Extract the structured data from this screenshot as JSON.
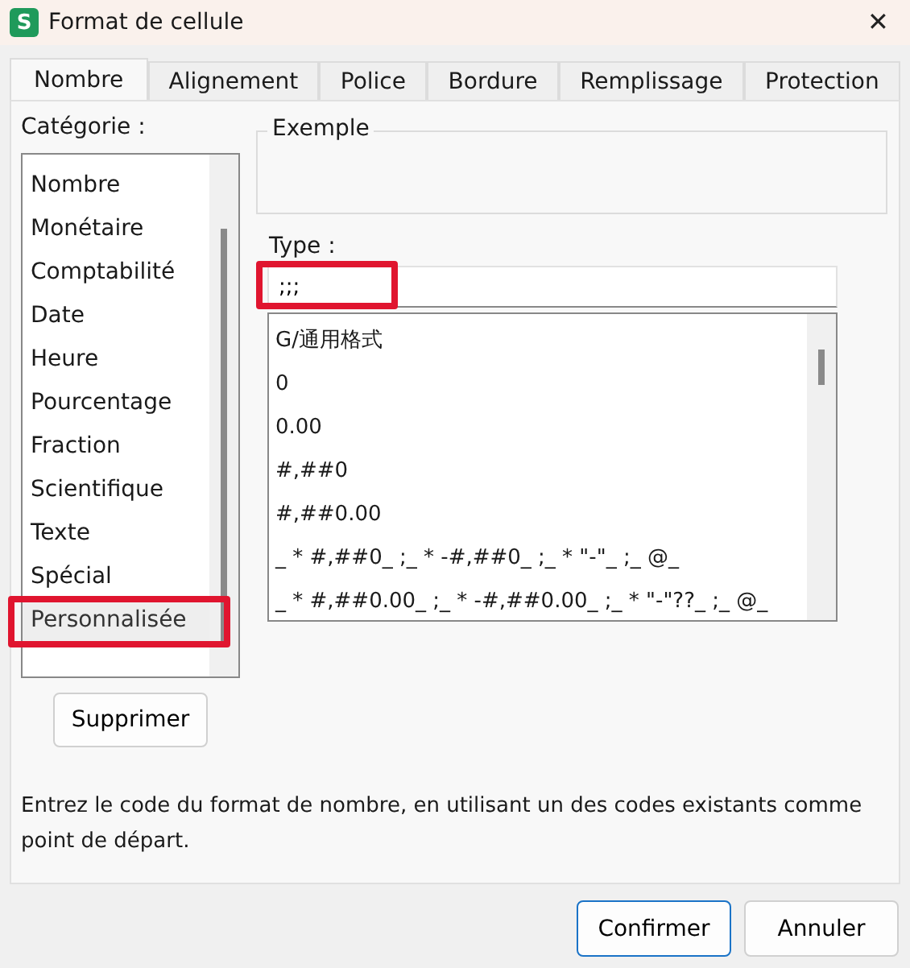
{
  "window": {
    "app_icon": "S",
    "title": "Format de cellule",
    "close": "✕"
  },
  "tabs": [
    {
      "label": "Nombre",
      "selected": true
    },
    {
      "label": "Alignement",
      "selected": false
    },
    {
      "label": "Police",
      "selected": false
    },
    {
      "label": "Bordure",
      "selected": false
    },
    {
      "label": "Remplissage",
      "selected": false
    },
    {
      "label": "Protection",
      "selected": false
    }
  ],
  "category": {
    "label": "Catégorie :",
    "items": [
      {
        "label": "Nombre",
        "selected": false,
        "highlighted": false
      },
      {
        "label": "Monétaire",
        "selected": false,
        "highlighted": false
      },
      {
        "label": "Comptabilité",
        "selected": false,
        "highlighted": false
      },
      {
        "label": "Date",
        "selected": false,
        "highlighted": false
      },
      {
        "label": "Heure",
        "selected": false,
        "highlighted": false
      },
      {
        "label": "Pourcentage",
        "selected": false,
        "highlighted": false
      },
      {
        "label": "Fraction",
        "selected": false,
        "highlighted": false
      },
      {
        "label": "Scientifique",
        "selected": false,
        "highlighted": false
      },
      {
        "label": "Texte",
        "selected": false,
        "highlighted": false
      },
      {
        "label": "Spécial",
        "selected": false,
        "highlighted": false
      },
      {
        "label": "Personnalisée",
        "selected": true,
        "highlighted": true
      }
    ]
  },
  "delete_button": "Supprimer",
  "example": {
    "label": "Exemple"
  },
  "type": {
    "label": "Type :",
    "value": ";;;",
    "highlighted": true
  },
  "formats": [
    {
      "label": "G/通用格式",
      "selected": false
    },
    {
      "label": "0",
      "selected": false
    },
    {
      "label": "0.00",
      "selected": false
    },
    {
      "label": "#,##0",
      "selected": false
    },
    {
      "label": "#,##0.00",
      "selected": false
    },
    {
      "label": "_ * #,##0_ ;_ * -#,##0_ ;_ * \"-\"_ ;_ @_",
      "selected": false
    },
    {
      "label": "_ * #,##0.00_ ;_ * -#,##0.00_ ;_ * \"-\"??_ ;_ @_",
      "selected": false
    }
  ],
  "description": "Entrez le code du format de nombre, en utilisant un des codes existants comme point de départ.",
  "buttons": [
    {
      "label": "Confirmer",
      "primary": true
    },
    {
      "label": "Annuler",
      "primary": false
    }
  ]
}
